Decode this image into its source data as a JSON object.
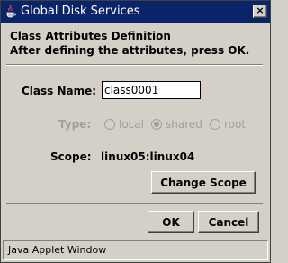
{
  "window": {
    "title": "Global Disk Services",
    "app_icon": "java-cup-icon",
    "close_icon": "close-icon",
    "close_glyph": "×"
  },
  "header": {
    "heading": "Class Attributes Definition",
    "instruction": "After defining the attributes, press OK."
  },
  "form": {
    "class_name_label": "Class Name:",
    "class_name_value": "class0001",
    "type_label": "Type:",
    "type_options": [
      {
        "label": "local",
        "selected": false
      },
      {
        "label": "shared",
        "selected": true
      },
      {
        "label": "root",
        "selected": false
      }
    ],
    "scope_label": "Scope:",
    "scope_value": "linux05:linux04",
    "change_scope_label": "Change Scope"
  },
  "buttons": {
    "ok_label": "OK",
    "cancel_label": "Cancel"
  },
  "status_bar": {
    "text": "Java Applet Window"
  },
  "colors": {
    "titlebar": "#0a246a",
    "window_bg": "#d4d0c8",
    "disabled_text": "#a0a0a0"
  }
}
